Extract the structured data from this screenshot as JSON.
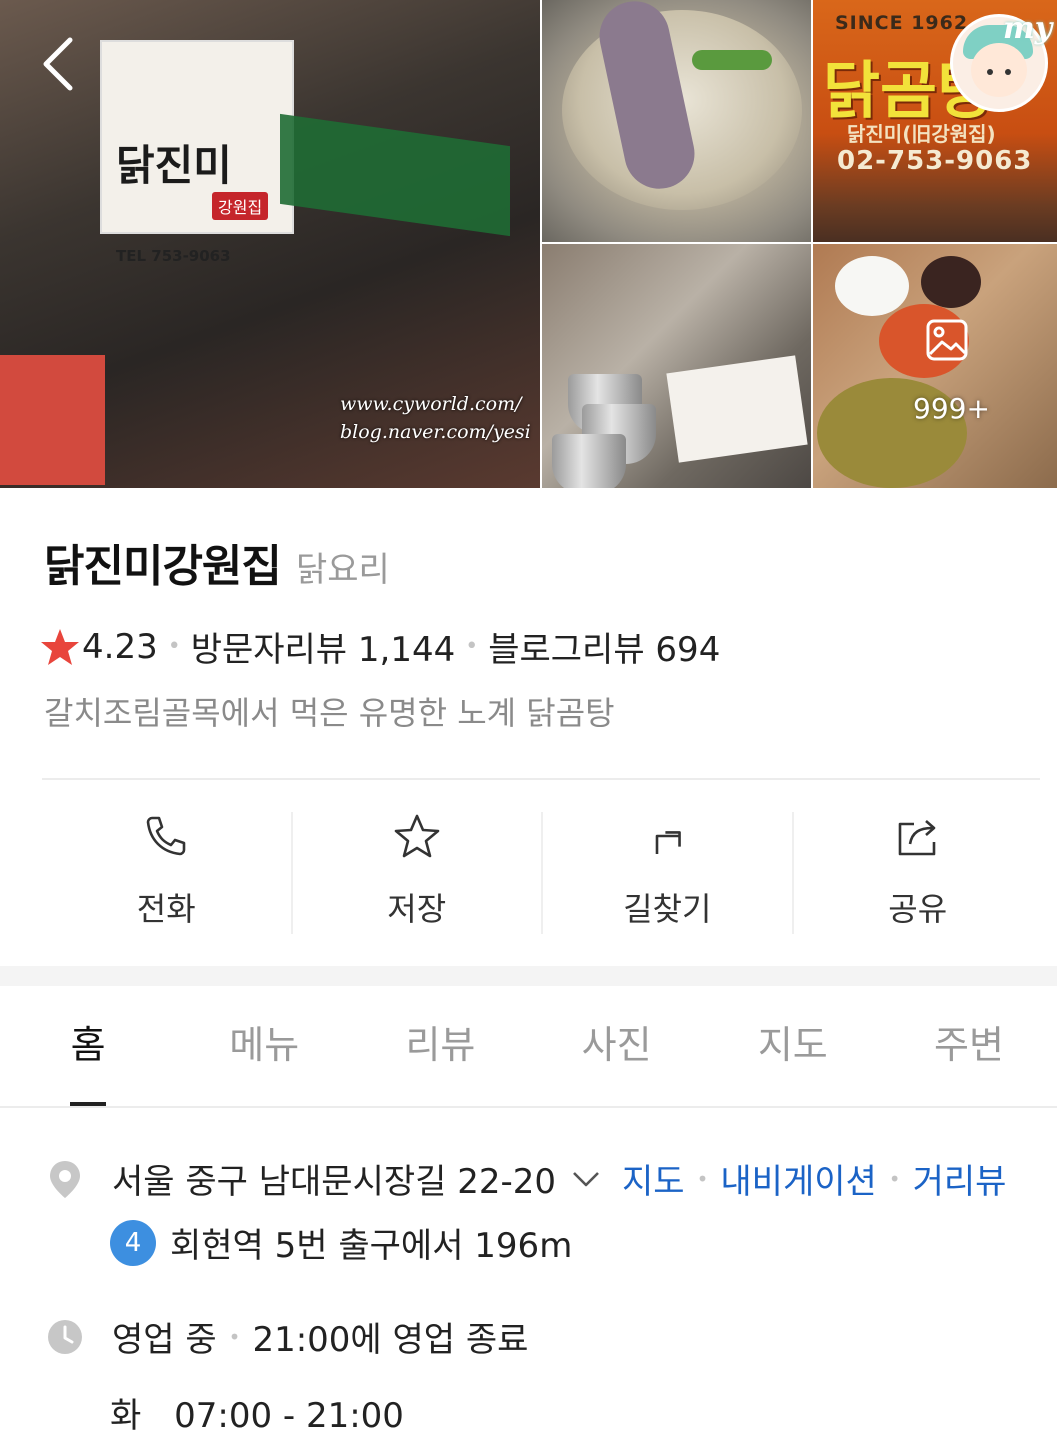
{
  "gallery": {
    "main_sign_title": "닭진미",
    "main_sign_sub": "강원집",
    "main_sign_tel": "TEL 753-9063",
    "watermark_line1": "www.cyworld.com/",
    "watermark_line2": "blog.naver.com/yesi",
    "sign_since": "SINCE 1962",
    "sign_title": "닭곰탕",
    "sign_name": "닭진미(旧강원집)",
    "sign_phone": "02-753-9063",
    "my_badge": "my",
    "photo_count": "999+"
  },
  "place": {
    "name": "닭진미강원집",
    "category": "닭요리",
    "rating": "4.23",
    "visitor_reviews": "방문자리뷰 1,144",
    "blog_reviews": "블로그리뷰 694",
    "tagline": "갈치조림골목에서 먹은 유명한 노계 닭곰탕"
  },
  "actions": {
    "call": "전화",
    "save": "저장",
    "directions": "길찾기",
    "share": "공유"
  },
  "tabs": [
    "홈",
    "메뉴",
    "리뷰",
    "사진",
    "지도",
    "주변"
  ],
  "info": {
    "address": "서울 중구 남대문시장길 22-20",
    "link_map": "지도",
    "link_nav": "내비게이션",
    "link_street": "거리뷰",
    "subway_line": "4",
    "subway_text": "회현역 5번 출구에서 196m",
    "status": "영업 중",
    "status_detail": "21:00에 영업 종료",
    "hours_day": "화",
    "hours_time": "07:00 - 21:00"
  },
  "colors": {
    "star": "#e8453c",
    "link": "#1b63c6",
    "subway_line_4": "#3d8fe0"
  }
}
